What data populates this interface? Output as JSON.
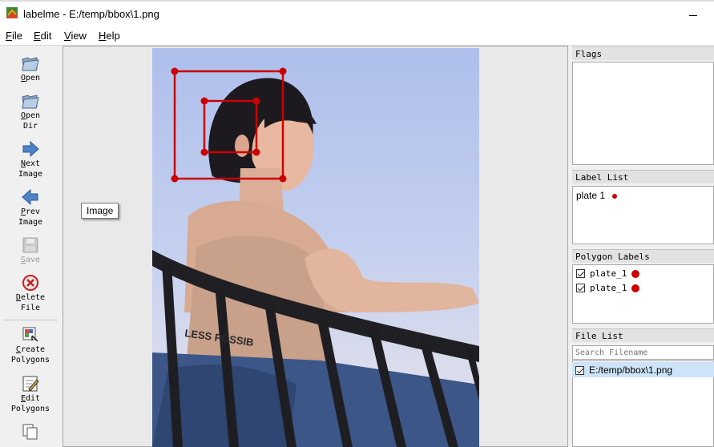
{
  "window": {
    "title": "labelme - E:/temp/bbox\\1.png"
  },
  "menu": [
    "File",
    "Edit",
    "View",
    "Help"
  ],
  "toolbar": {
    "open": "Open",
    "open_dir": "Open\nDir",
    "next_image": "Next\nImage",
    "prev_image": "Prev\nImage",
    "save": "Save",
    "delete_file": "Delete\nFile",
    "create_polygons": "Create\nPolygons",
    "edit_polygons": "Edit\nPolygons"
  },
  "canvas": {
    "tooltip": "Image",
    "shape_color": "#cc0000"
  },
  "docks": {
    "flags": {
      "title": "Flags"
    },
    "label_list": {
      "title": "Label List",
      "items": [
        {
          "label": "plate 1",
          "color": "#cc0000"
        }
      ]
    },
    "polygon_labels": {
      "title": "Polygon Labels",
      "items": [
        {
          "label": "plate_1",
          "checked": true,
          "color": "#cc0000"
        },
        {
          "label": "plate_1",
          "checked": true,
          "color": "#cc0000"
        }
      ]
    },
    "file_list": {
      "title": "File List",
      "search_placeholder": "Search Filename",
      "items": [
        {
          "path": "E:/temp/bbox\\1.png",
          "checked": true
        }
      ]
    }
  }
}
